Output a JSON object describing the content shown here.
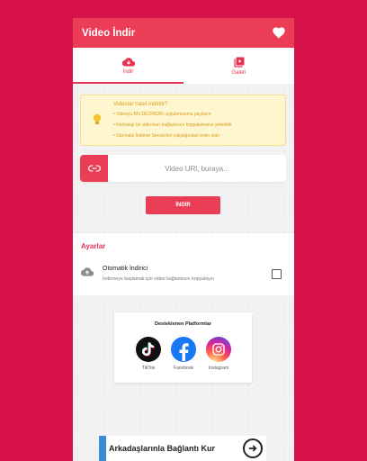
{
  "app": {
    "title": "Video İndir",
    "accent": "#ec3d57",
    "background": "#d8134a"
  },
  "tabs": [
    {
      "label": "İndir",
      "icon": "cloud-download-icon",
      "active": true
    },
    {
      "label": "Galeri",
      "icon": "video-library-icon",
      "active": false
    }
  ],
  "info": {
    "question": "Videolar nasıl indirilir?",
    "bullets": [
      "• Videoyu BİV.DEOİNDİR uygulamasına paylaşın",
      "• Herhangi bir videonun bağlantısını kopyalamanız yeterlidir",
      "• Otomatik İndirme Servisi'nin çalıştığından emin olun"
    ]
  },
  "url_input": {
    "placeholder": "Video URl, buraya...",
    "value": ""
  },
  "download_button": "İNDİR",
  "settings": {
    "section_title": "Ayarlar",
    "auto_download_title": "Otomatik İndirici",
    "auto_download_desc": "İndirmeye başlamak için video bağlantısını kopyalayın",
    "auto_download_checked": false
  },
  "platforms": {
    "title": "Desteklenen Platformlar",
    "items": [
      {
        "label": "TikTok",
        "icon": "tiktok-icon"
      },
      {
        "label": "Facebook",
        "icon": "facebook-icon"
      },
      {
        "label": "Instagram",
        "icon": "instagram-icon"
      }
    ]
  },
  "ad": {
    "text": "Arkadaşlarınla Bağlantı Kur"
  }
}
